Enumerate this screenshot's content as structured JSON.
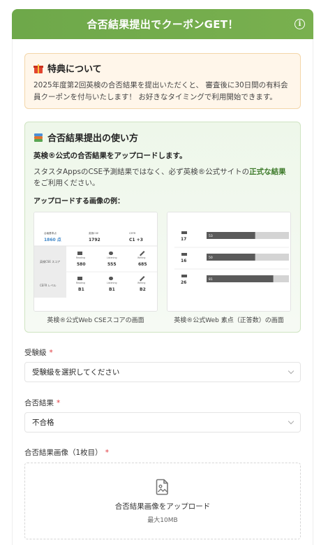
{
  "header": {
    "title": "合否結果提出でクーポンGET！",
    "info_icon": "info-icon"
  },
  "benefit": {
    "icon": "gift-icon",
    "title": "特典について",
    "text": "2025年度第2回英検の合否結果を提出いただくと、 審査後に30日間の有料会員クーポンを付与いたします！ お好きなタイミングで利用開始できます。"
  },
  "howto": {
    "icon": "books-icon",
    "title": "合否結果提出の使い方",
    "lead": "英検®公式の合否結果をアップロードします。",
    "text_before": "スタスタAppsのCSE予測結果ではなく、必ず英検®公式サイトの",
    "text_bold": "正式な結果",
    "text_after": "をご利用ください。",
    "examples_label": "アップロードする画像の例：",
    "example1": {
      "caption": "英検®公式Web CSEスコアの画面",
      "head_labels": [
        "合格基準点",
        "英検CSE",
        "CEFR"
      ],
      "head_values": [
        "1860 点",
        "1792",
        "C1 +3"
      ],
      "row_labels": [
        "英検CSE スコア",
        "CEFR レベル"
      ],
      "skills": [
        "Reading",
        "Listening",
        "Writing"
      ],
      "scores": [
        "580",
        "555",
        "685"
      ],
      "levels": [
        "B1",
        "B1",
        "B2"
      ]
    },
    "example2": {
      "caption": "英検®公式Web 素点（正答数）の画面",
      "rows": [
        {
          "count": "17",
          "bar": "53",
          "fill": 0.59
        },
        {
          "count": "16",
          "bar": "50",
          "fill": 0.59
        },
        {
          "count": "26",
          "bar": "81",
          "fill": 0.81
        }
      ]
    }
  },
  "form": {
    "grade": {
      "label": "受験級",
      "required": "*",
      "value": "受験級を選択してください"
    },
    "result": {
      "label": "合否結果",
      "required": "*",
      "value": "不合格"
    },
    "image": {
      "label": "合否結果画像（1枚目）",
      "required": "*",
      "icon": "image-upload-icon",
      "upload_label": "合否結果画像をアップロード",
      "max": "最大10MB"
    }
  },
  "colors": {
    "header": "#6ea84a",
    "accent_green": "#3d7a2a",
    "required": "#e0393e"
  }
}
